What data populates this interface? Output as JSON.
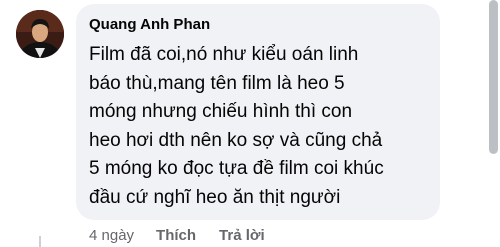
{
  "comment": {
    "author": "Quang Anh Phan",
    "text_lines": [
      "Film đã coi,nó như kiểu oán linh",
      "báo thù,mang tên film là heo 5",
      "móng nhưng chiếu hình thì con",
      "heo hơi dth nên ko sợ và cũng chả",
      "5 móng ko đọc tựa đề film coi khúc",
      "đầu cứ nghĩ heo ăn thịt người"
    ],
    "time": "4 ngày",
    "like_label": "Thích",
    "reply_label": "Trả lời"
  },
  "icons": {
    "avatar": "user-avatar"
  },
  "colors": {
    "bubble": "#f0f2f5",
    "text": "#050505",
    "secondary": "#65676b",
    "scroll_thumb": "#bcc0c4"
  }
}
